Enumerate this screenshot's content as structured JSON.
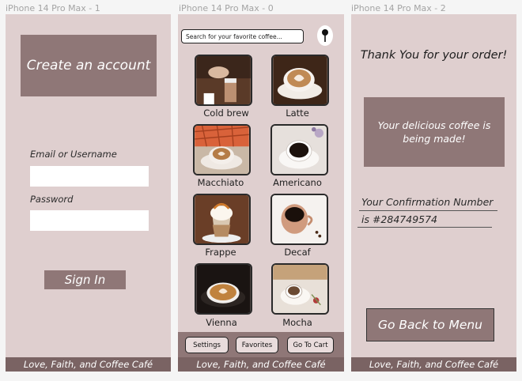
{
  "frames": {
    "login": "iPhone 14 Pro Max - 1",
    "menu": "iPhone 14 Pro Max - 0",
    "confirmation": "iPhone 14 Pro Max - 2"
  },
  "footer_text": "Love, Faith, and Coffee Café",
  "login": {
    "title": "Create an account",
    "username_label": "Email or Username",
    "password_label": "Password",
    "signin_label": "Sign In"
  },
  "menu": {
    "search_placeholder": "Search for your favorite coffee...",
    "pin_icon": "map-pin-icon",
    "items": [
      {
        "label": "Cold brew"
      },
      {
        "label": "Latte"
      },
      {
        "label": "Macchiato"
      },
      {
        "label": "Americano"
      },
      {
        "label": "Frappe"
      },
      {
        "label": "Decaf"
      },
      {
        "label": "Vienna"
      },
      {
        "label": "Mocha"
      }
    ],
    "nav": {
      "settings": "Settings",
      "favorites": "Favorites",
      "cart": "Go To Cart"
    }
  },
  "confirmation": {
    "thanks": "Thank You for your order!",
    "status": "Your delicious coffee is being made!",
    "number_line1": "Your Confirmation Number",
    "number_line2": "is #284749574",
    "back_label": "Go Back to Menu"
  },
  "colors": {
    "phone_bg": "#dfcfcf",
    "accent": "#8f7777",
    "footer": "#7a6363"
  }
}
